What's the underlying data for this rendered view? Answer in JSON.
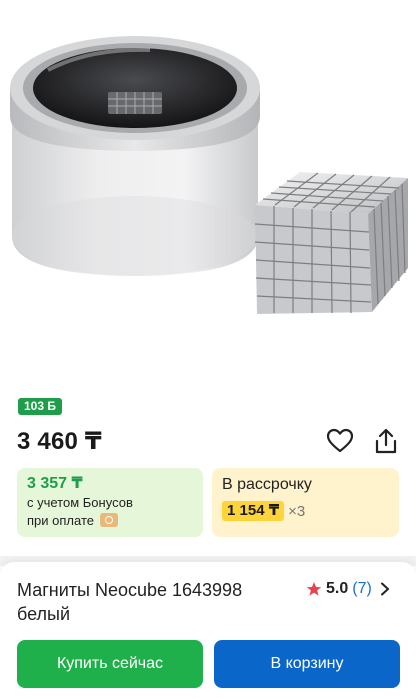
{
  "product": {
    "bonus_badge": "103 Б",
    "price": "3 460 ₸",
    "bonus_price": "3 357 ₸",
    "bonus_line1": "с учетом Бонусов",
    "bonus_line2": "при оплате",
    "installment_title": "В рассрочку",
    "installment_price": "1 154 ₸",
    "installment_multiplier": "×3",
    "title": "Магниты Neocube 1643998 белый",
    "rating": "5.0",
    "reviews": "(7)"
  },
  "actions": {
    "buy_now": "Купить сейчас",
    "add_to_cart": "В корзину"
  },
  "colors": {
    "green": "#1fb04b",
    "blue": "#0b66c9",
    "bonus_bg": "#e6f7d9",
    "installment_bg": "#fff3cd",
    "installment_highlight": "#ffd43b"
  }
}
